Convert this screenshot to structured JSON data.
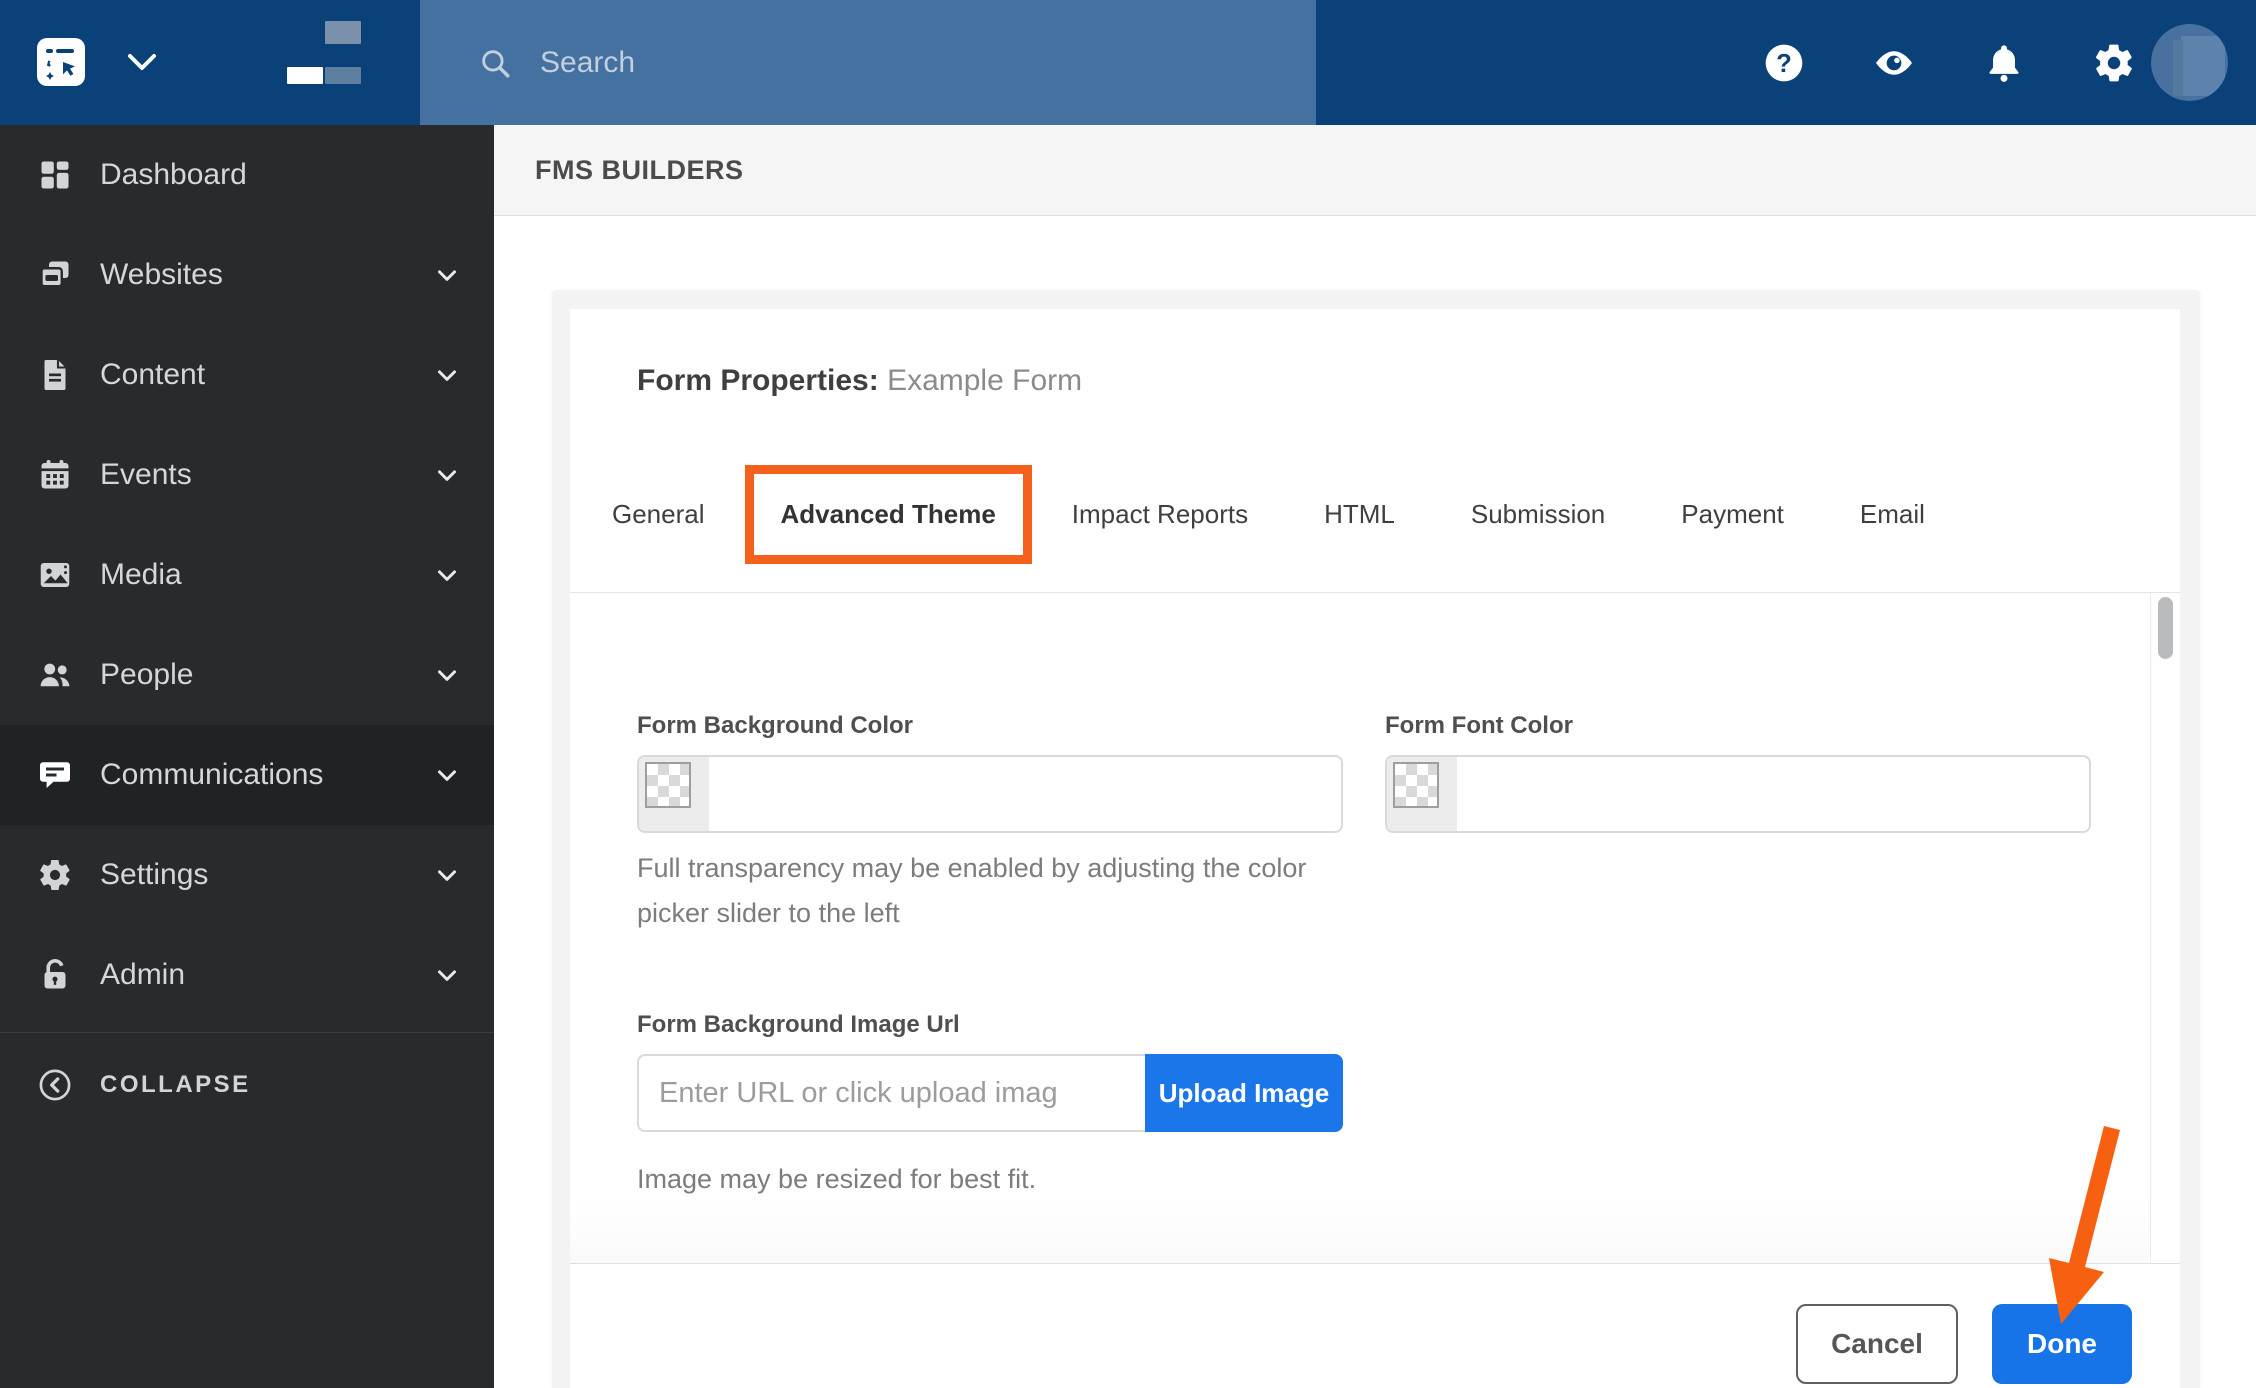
{
  "topbar": {
    "search_placeholder": "Search",
    "icons": [
      {
        "name": "help-icon"
      },
      {
        "name": "eye-icon"
      },
      {
        "name": "bell-icon"
      },
      {
        "name": "gear-icon"
      }
    ]
  },
  "sidebar": {
    "items": [
      {
        "label": "Dashboard",
        "icon": "grid",
        "chevron": false,
        "selected": false
      },
      {
        "label": "Websites",
        "icon": "browser",
        "chevron": true,
        "selected": false
      },
      {
        "label": "Content",
        "icon": "file",
        "chevron": true,
        "selected": false
      },
      {
        "label": "Events",
        "icon": "calendar",
        "chevron": true,
        "selected": false
      },
      {
        "label": "Media",
        "icon": "image",
        "chevron": true,
        "selected": false
      },
      {
        "label": "People",
        "icon": "people",
        "chevron": true,
        "selected": false
      },
      {
        "label": "Communications",
        "icon": "chat",
        "chevron": true,
        "selected": true
      },
      {
        "label": "Settings",
        "icon": "gear",
        "chevron": true,
        "selected": false
      },
      {
        "label": "Admin",
        "icon": "unlock",
        "chevron": true,
        "selected": false
      }
    ],
    "collapse_label": "COLLAPSE"
  },
  "page_header": {
    "title": "FMS BUILDERS"
  },
  "modal": {
    "title_prefix": "Form Properties:",
    "title_value": "Example Form",
    "tabs": [
      {
        "label": "General",
        "active": false
      },
      {
        "label": "Advanced Theme",
        "active": true
      },
      {
        "label": "Impact Reports",
        "active": false
      },
      {
        "label": "HTML",
        "active": false
      },
      {
        "label": "Submission",
        "active": false
      },
      {
        "label": "Payment",
        "active": false
      },
      {
        "label": "Email",
        "active": false
      }
    ],
    "fields": {
      "bg_color_label": "Form Background Color",
      "font_color_label": "Form Font Color",
      "transparency_help": "Full transparency may be enabled by adjusting the color picker slider to the left",
      "image_url_label": "Form Background Image Url",
      "image_url_placeholder": "Enter URL or click upload imag",
      "upload_button_label": "Upload Image",
      "resize_help": "Image may be resized for best fit."
    },
    "footer": {
      "cancel_label": "Cancel",
      "done_label": "Done"
    }
  },
  "colors": {
    "topbar_navy": "#0b4179",
    "search_bg": "#44719f",
    "sidebar_bg": "#282b2e",
    "sidebar_selected_bg": "#1f2326",
    "accent_blue": "#1b76e9",
    "done_blue": "#1673e8",
    "annotation_orange": "#f4611c",
    "header_bg": "#f5f5f6"
  }
}
